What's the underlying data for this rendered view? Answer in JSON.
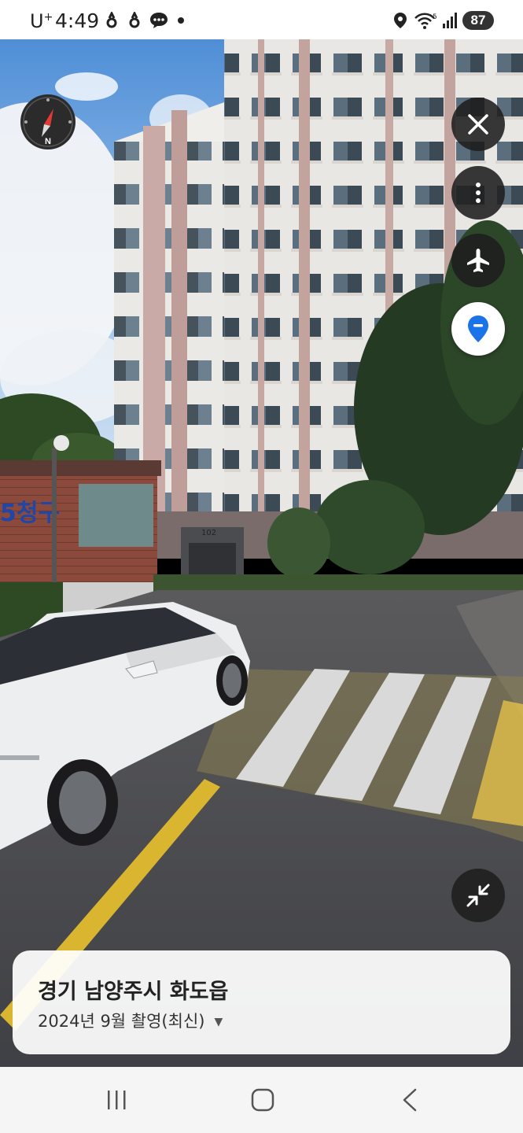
{
  "status_bar": {
    "carrier": "U",
    "carrier_sup": "+",
    "time": "4:49",
    "battery": "87",
    "network": "5"
  },
  "street_view": {
    "compass_label": "N",
    "building_number": "102",
    "sign_text": "5청구",
    "location": {
      "title": "경기 남양주시 화도읍",
      "capture_date": "2024년 9월 촬영(최신)"
    }
  },
  "icons": {
    "close": "close-icon",
    "more": "more-vertical-icon",
    "airplane": "airplane-icon",
    "pin": "location-pin-icon",
    "minimize": "minimize-icon",
    "compass": "compass-icon"
  },
  "colors": {
    "pin_blue": "#1a73e8",
    "compass_red": "#e53935",
    "fab_bg": "#1e1e1e"
  }
}
